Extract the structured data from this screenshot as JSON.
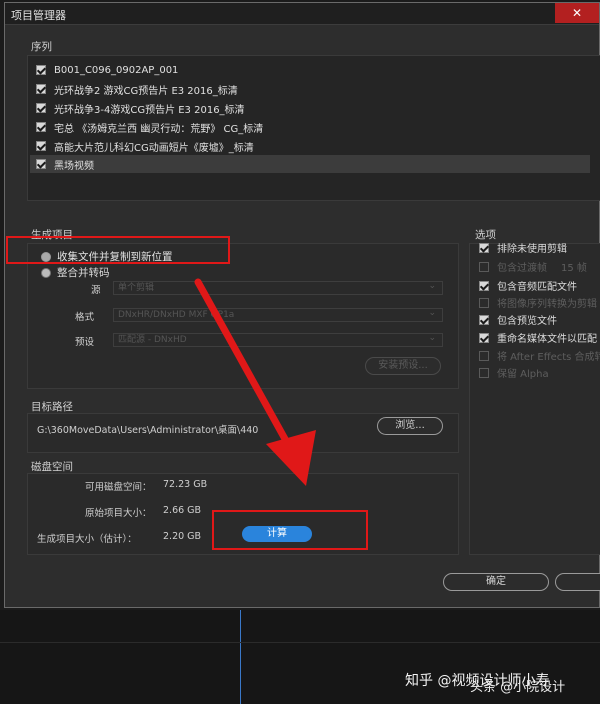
{
  "window": {
    "title": "项目管理器",
    "close_glyph": "✕"
  },
  "sequence": {
    "label": "序列",
    "items": [
      {
        "label": "B001_C096_0902AP_001",
        "checked": true
      },
      {
        "label": "光环战争2 游戏CG预告片 E3 2016_标清",
        "checked": true
      },
      {
        "label": "光环战争3-4游戏CG预告片 E3 2016_标清",
        "checked": true
      },
      {
        "label": "宅总 《汤姆克兰西 幽灵行动：荒野》 CG_标清",
        "checked": true
      },
      {
        "label": "高能大片范儿科幻CG动画短片《废墟》_标清",
        "checked": true
      },
      {
        "label": "黑场视频",
        "checked": true
      }
    ]
  },
  "generate": {
    "label": "生成项目",
    "option_collect": "收集文件并复制到新位置",
    "option_transcode": "整合并转码",
    "fields": [
      {
        "label": "源",
        "value": "单个剪辑"
      },
      {
        "label": "格式",
        "value": "DNxHR/DNxHD MXF OP1a"
      },
      {
        "label": "预设",
        "value": "匹配源 - DNxHD"
      }
    ],
    "install_preset": "安装预设..."
  },
  "options": {
    "label": "选项",
    "items": [
      {
        "label": "排除未使用剪辑",
        "checked": true,
        "enabled": true
      },
      {
        "label": "包含过渡帧",
        "suffix": "15 帧",
        "checked": false,
        "enabled": false
      },
      {
        "label": "包含音频匹配文件",
        "checked": true,
        "enabled": true
      },
      {
        "label": "将图像序列转换为剪辑",
        "checked": false,
        "enabled": false
      },
      {
        "label": "包含预览文件",
        "checked": true,
        "enabled": true
      },
      {
        "label": "重命名媒体文件以匹配",
        "checked": true,
        "enabled": true
      },
      {
        "label": "将 After Effects 合成转换",
        "checked": false,
        "enabled": false
      },
      {
        "label": "保留 Alpha",
        "checked": false,
        "enabled": false
      }
    ]
  },
  "target": {
    "label": "目标路径",
    "path": "G:\\360MoveData\\Users\\Administrator\\桌面\\440",
    "browse_label": "浏览..."
  },
  "disk": {
    "label": "磁盘空间",
    "available_label": "可用磁盘空间：",
    "available_value": "72.23 GB",
    "original_label": "原始项目大小：",
    "original_value": "2.66 GB",
    "generated_label": "生成项目大小（估计）：",
    "generated_value": "2.20 GB",
    "calc_label": "计算"
  },
  "footer": {
    "ok_label": "确定"
  },
  "watermark": {
    "text": "知乎 @视频设计师小寿",
    "text2": "头条 @小院设计"
  },
  "colors": {
    "annotation": "#e01818",
    "accent": "#2a84dc"
  }
}
